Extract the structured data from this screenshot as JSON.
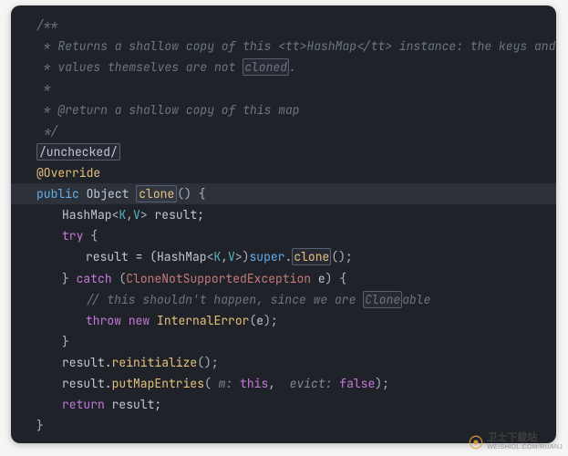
{
  "doc": {
    "l1": "/**",
    "l2": " * Returns a shallow copy of this <tt>HashMap</tt> instance: the keys and",
    "l3_a": " * values themselves are not ",
    "l3_box": "cloned",
    "l3_b": ".",
    "l4": " *",
    "l5": " * @return a shallow copy of this map",
    "l6": " */"
  },
  "suppress": "/unchecked/",
  "override": "@Override",
  "sig": {
    "public": "public",
    "ret": "Object",
    "name": "clone",
    "after": "() {"
  },
  "decl": {
    "type": "HashMap",
    "lt": "<",
    "k": "K",
    "comma": ",",
    "v": "V",
    "gt": ">",
    "name": " result;"
  },
  "try": "try",
  "assign": {
    "lhs": "result = (HashMap",
    "lt": "<",
    "k": "K",
    "comma": ",",
    "v": "V",
    "gt": ">",
    "rparen": ")",
    "super": "super",
    "dot": ".",
    "clone": "clone",
    "tail": "();"
  },
  "catch": {
    "close_try": "}",
    "kw": "catch",
    "open": " (",
    "ex": "CloneNotSupportedException",
    "var": " e",
    "close": ") {"
  },
  "inner_comment": {
    "a": "// this shouldn't happen, since we are ",
    "box": "Clone",
    "b": "able"
  },
  "throw": {
    "throw": "throw",
    "new": "new",
    "cls": "InternalError",
    "args": "(",
    "e": "e",
    "tail": ");"
  },
  "close_catch": "}",
  "reinit": {
    "obj": "result.",
    "m": "reinitialize",
    "tail": "();"
  },
  "put": {
    "obj": "result.",
    "m": "putMapEntries",
    "open": "( ",
    "p1": "m:",
    "v1": "this",
    "sep": ",  ",
    "p2": "evict:",
    "v2": "false",
    "tail": ");"
  },
  "ret": {
    "kw": "return",
    "v": " result;"
  },
  "close_method": "}",
  "watermark": {
    "cn": "卫士下载站",
    "en": "WEISHIDL.COM/RUANJ"
  }
}
